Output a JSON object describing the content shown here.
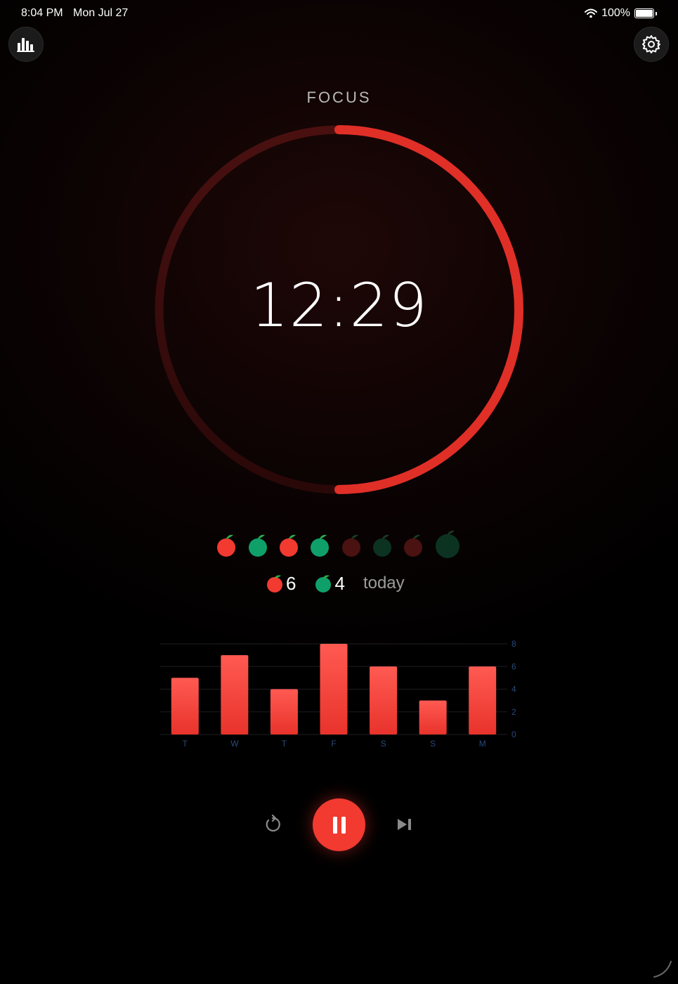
{
  "status_bar": {
    "time": "8:04 PM",
    "date": "Mon Jul 27",
    "battery": "100%"
  },
  "header": {
    "mode_label": "FOCUS"
  },
  "timer": {
    "display": "12:29",
    "progress_remaining": 0.5
  },
  "sessions": [
    "focus-done",
    "break-done",
    "focus-done",
    "break-done",
    "focus-pending",
    "break-pending",
    "focus-pending",
    "long-break-pending"
  ],
  "tally": {
    "focus_count": "6",
    "break_count": "4",
    "label": "today"
  },
  "chart_data": {
    "type": "bar",
    "categories": [
      "T",
      "W",
      "T",
      "F",
      "S",
      "S",
      "M"
    ],
    "values": [
      5,
      7,
      4,
      8,
      6,
      3,
      6
    ],
    "ylim": [
      0,
      8
    ],
    "yticks": [
      "0",
      "2",
      "4",
      "6",
      "8"
    ],
    "grid": true,
    "color": "#f23a30"
  },
  "colors": {
    "accent": "#f23a30",
    "break": "#0fa06a",
    "background": "#000000"
  },
  "icons": {
    "stats": "bar-chart-icon",
    "settings": "gear-icon",
    "reset": "reset-icon",
    "pause": "pause-icon",
    "skip": "skip-forward-icon"
  }
}
